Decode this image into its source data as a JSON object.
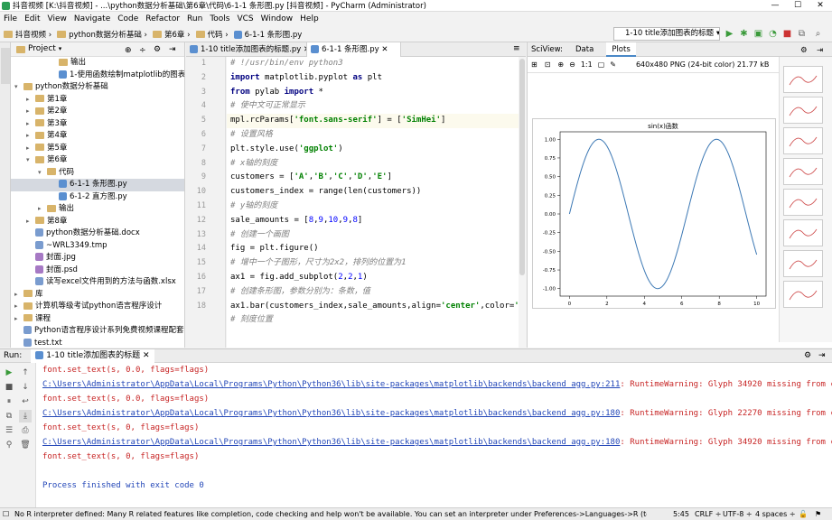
{
  "window": {
    "title": "抖音视频 [K:\\抖音视频] - ...\\python数据分析基础\\第6章\\代码\\6-1-1 条形图.py [抖音视频] - PyCharm (Administrator)",
    "minimize": "—",
    "maximize": "☐",
    "close": "✕"
  },
  "menu": [
    "File",
    "Edit",
    "View",
    "Navigate",
    "Code",
    "Refactor",
    "Run",
    "Tools",
    "VCS",
    "Window",
    "Help"
  ],
  "breadcrumbs": [
    "抖音视频",
    "python数据分析基础",
    "第6章",
    "代码",
    "6-1-1 条形图.py"
  ],
  "run_config": "1-10 title添加图表的标题",
  "project": {
    "header": "Project",
    "tree": [
      {
        "label": "输出",
        "indent": 3,
        "arrow": "",
        "type": "folder"
      },
      {
        "label": "1-使用函数绘制matplotlib的图表组成元素.py",
        "indent": 3,
        "arrow": "",
        "type": "py"
      },
      {
        "label": "python数据分析基础",
        "indent": 0,
        "arrow": "▾",
        "type": "folder"
      },
      {
        "label": "第1章",
        "indent": 1,
        "arrow": "▸",
        "type": "folder"
      },
      {
        "label": "第2章",
        "indent": 1,
        "arrow": "▸",
        "type": "folder"
      },
      {
        "label": "第3章",
        "indent": 1,
        "arrow": "▸",
        "type": "folder"
      },
      {
        "label": "第4章",
        "indent": 1,
        "arrow": "▸",
        "type": "folder"
      },
      {
        "label": "第5章",
        "indent": 1,
        "arrow": "▸",
        "type": "folder"
      },
      {
        "label": "第6章",
        "indent": 1,
        "arrow": "▾",
        "type": "folder"
      },
      {
        "label": "代码",
        "indent": 2,
        "arrow": "▾",
        "type": "folder"
      },
      {
        "label": "6-1-1 条形图.py",
        "indent": 3,
        "arrow": "",
        "type": "py",
        "selected": true
      },
      {
        "label": "6-1-2 直方图.py",
        "indent": 3,
        "arrow": "",
        "type": "py"
      },
      {
        "label": "输出",
        "indent": 2,
        "arrow": "▸",
        "type": "folder"
      },
      {
        "label": "第8章",
        "indent": 1,
        "arrow": "▸",
        "type": "folder"
      },
      {
        "label": "python数据分析基础.docx",
        "indent": 1,
        "arrow": "",
        "type": "doc"
      },
      {
        "label": "~WRL3349.tmp",
        "indent": 1,
        "arrow": "",
        "type": "doc"
      },
      {
        "label": "封面.jpg",
        "indent": 1,
        "arrow": "",
        "type": "img"
      },
      {
        "label": "封面.psd",
        "indent": 1,
        "arrow": "",
        "type": "img"
      },
      {
        "label": "读写excel文件用到的方法与函数.xlsx",
        "indent": 1,
        "arrow": "",
        "type": "doc"
      },
      {
        "label": "库",
        "indent": 0,
        "arrow": "▸",
        "type": "folder"
      },
      {
        "label": "计算机等级考试python语言程序设计",
        "indent": 0,
        "arrow": "▸",
        "type": "folder"
      },
      {
        "label": "课程",
        "indent": 0,
        "arrow": "▸",
        "type": "folder"
      },
      {
        "label": "Python语言程序设计系列免费视频课程配套课件.docx",
        "indent": 0,
        "arrow": "",
        "type": "doc"
      },
      {
        "label": "test.txt",
        "indent": 0,
        "arrow": "",
        "type": "doc"
      }
    ]
  },
  "editor": {
    "tabs": [
      "1-10 title添加图表的标题.py",
      "6-1-1 条形图.py"
    ],
    "line_numbers": [
      "1",
      "2",
      "3",
      "4",
      "5",
      "6",
      "7",
      "8",
      "9",
      "10",
      "11",
      "12",
      "13",
      "14",
      "15",
      "16",
      "17",
      "18"
    ],
    "code": [
      [
        {
          "c": "cmt",
          "t": "# !/usr/bin/env python3"
        }
      ],
      [
        {
          "c": "kw",
          "t": "import "
        },
        {
          "c": "",
          "t": "matplotlib.pyplot "
        },
        {
          "c": "kw",
          "t": "as "
        },
        {
          "c": "",
          "t": "plt"
        }
      ],
      [
        {
          "c": "kw",
          "t": "from "
        },
        {
          "c": "",
          "t": "pylab "
        },
        {
          "c": "kw",
          "t": "import "
        },
        {
          "c": "",
          "t": "*"
        }
      ],
      [
        {
          "c": "cmt",
          "t": "# 使中文可正常显示"
        }
      ],
      [
        {
          "c": "",
          "t": "mpl.rcParams["
        },
        {
          "c": "str",
          "t": "'font.sans-serif'"
        },
        {
          "c": "",
          "t": "] = ["
        },
        {
          "c": "str",
          "t": "'SimHei'"
        },
        {
          "c": "",
          "t": "]"
        }
      ],
      [
        {
          "c": "cmt",
          "t": "# 设置风格"
        }
      ],
      [
        {
          "c": "",
          "t": "plt.style.use("
        },
        {
          "c": "str",
          "t": "'ggplot'"
        },
        {
          "c": "",
          "t": ")"
        }
      ],
      [
        {
          "c": "cmt",
          "t": "# x轴的刻度"
        }
      ],
      [
        {
          "c": "",
          "t": "customers = ["
        },
        {
          "c": "str",
          "t": "'A'"
        },
        {
          "c": "",
          "t": ","
        },
        {
          "c": "str",
          "t": "'B'"
        },
        {
          "c": "",
          "t": ","
        },
        {
          "c": "str",
          "t": "'C'"
        },
        {
          "c": "",
          "t": ","
        },
        {
          "c": "str",
          "t": "'D'"
        },
        {
          "c": "",
          "t": ","
        },
        {
          "c": "str",
          "t": "'E'"
        },
        {
          "c": "",
          "t": "]"
        }
      ],
      [
        {
          "c": "",
          "t": "customers_index = range(len(customers))"
        }
      ],
      [
        {
          "c": "cmt",
          "t": "# y轴的刻度"
        }
      ],
      [
        {
          "c": "",
          "t": "sale_amounts = ["
        },
        {
          "c": "num",
          "t": "8"
        },
        {
          "c": "",
          "t": ","
        },
        {
          "c": "num",
          "t": "9"
        },
        {
          "c": "",
          "t": ","
        },
        {
          "c": "num",
          "t": "10"
        },
        {
          "c": "",
          "t": ","
        },
        {
          "c": "num",
          "t": "9"
        },
        {
          "c": "",
          "t": ","
        },
        {
          "c": "num",
          "t": "8"
        },
        {
          "c": "",
          "t": "]"
        }
      ],
      [
        {
          "c": "cmt",
          "t": "# 创建一个画图"
        }
      ],
      [
        {
          "c": "",
          "t": "fig = plt.figure()"
        }
      ],
      [
        {
          "c": "cmt",
          "t": "# 增中一个子图形，尺寸为2x2，排列的位置为1"
        }
      ],
      [
        {
          "c": "",
          "t": "ax1 = fig.add_subplot("
        },
        {
          "c": "num",
          "t": "2"
        },
        {
          "c": "",
          "t": ","
        },
        {
          "c": "num",
          "t": "2"
        },
        {
          "c": "",
          "t": ","
        },
        {
          "c": "num",
          "t": "1"
        },
        {
          "c": "",
          "t": ")"
        }
      ],
      [
        {
          "c": "cmt",
          "t": "# 创建条形图，参数分别为：条数，值"
        }
      ],
      [
        {
          "c": "",
          "t": "ax1.bar(customers_index,sale_amounts,align="
        },
        {
          "c": "str",
          "t": "'center'"
        },
        {
          "c": "",
          "t": ",color="
        },
        {
          "c": "str",
          "t": "'darkb"
        }
      ],
      [
        {
          "c": "cmt",
          "t": "# 刻度位置"
        }
      ]
    ]
  },
  "sciview": {
    "label": "SciView:",
    "tabs": [
      "Data",
      "Plots"
    ],
    "image_info": "640x480 PNG (24-bit color) 21.77 kB"
  },
  "chart_data": {
    "type": "line",
    "title": "sin(x)函数",
    "xlim": [
      -0.5,
      10.5
    ],
    "ylim": [
      -1.1,
      1.1
    ],
    "xticks": [
      "0",
      "2",
      "4",
      "6",
      "8",
      "10"
    ],
    "yticks": [
      "1.00",
      "0.75",
      "0.50",
      "0.25",
      "0.00",
      "-0.25",
      "-0.50",
      "-0.75",
      "-1.00"
    ],
    "series": [
      {
        "function": "sin",
        "x_range": [
          0,
          10
        ],
        "color": "#3c78b4"
      }
    ],
    "grid": false
  },
  "run": {
    "label": "Run:",
    "tab": "1-10 title添加图表的标题",
    "output": [
      {
        "t": "    font.set_text(s, 0.0, flags=flags)",
        "link": "",
        "rest": ""
      },
      {
        "t": "",
        "link": "C:\\Users\\Administrator\\AppData\\Local\\Programs\\Python\\Python36\\lib\\site-packages\\matplotlib\\backends\\backend_agg.py:211",
        "rest": ": RuntimeWarning: Glyph 34920 missing from current font."
      },
      {
        "t": "    font.set_text(s, 0.0, flags=flags)",
        "link": "",
        "rest": ""
      },
      {
        "t": "",
        "link": "C:\\Users\\Administrator\\AppData\\Local\\Programs\\Python\\Python36\\lib\\site-packages\\matplotlib\\backends\\backend_agg.py:180",
        "rest": ": RuntimeWarning: Glyph 22270 missing from current font."
      },
      {
        "t": "    font.set_text(s, 0, flags=flags)",
        "link": "",
        "rest": ""
      },
      {
        "t": "",
        "link": "C:\\Users\\Administrator\\AppData\\Local\\Programs\\Python\\Python36\\lib\\site-packages\\matplotlib\\backends\\backend_agg.py:180",
        "rest": ": RuntimeWarning: Glyph 34920 missing from current font."
      },
      {
        "t": "    font.set_text(s, 0, flags=flags)",
        "link": "",
        "rest": ""
      },
      {
        "t": "",
        "link": "",
        "rest": ""
      },
      {
        "t": "Process finished with exit code 0",
        "link": "",
        "rest": ""
      }
    ]
  },
  "status": {
    "message": "No R interpreter defined: Many R related features like completion, code checking and help won't be available. You can set an interpreter under Preferences->Languages->R (today 10:14)",
    "position": "5:45",
    "line_sep": "CRLF ÷",
    "encoding": "UTF-8 ÷",
    "indent": "4 spaces ÷"
  }
}
